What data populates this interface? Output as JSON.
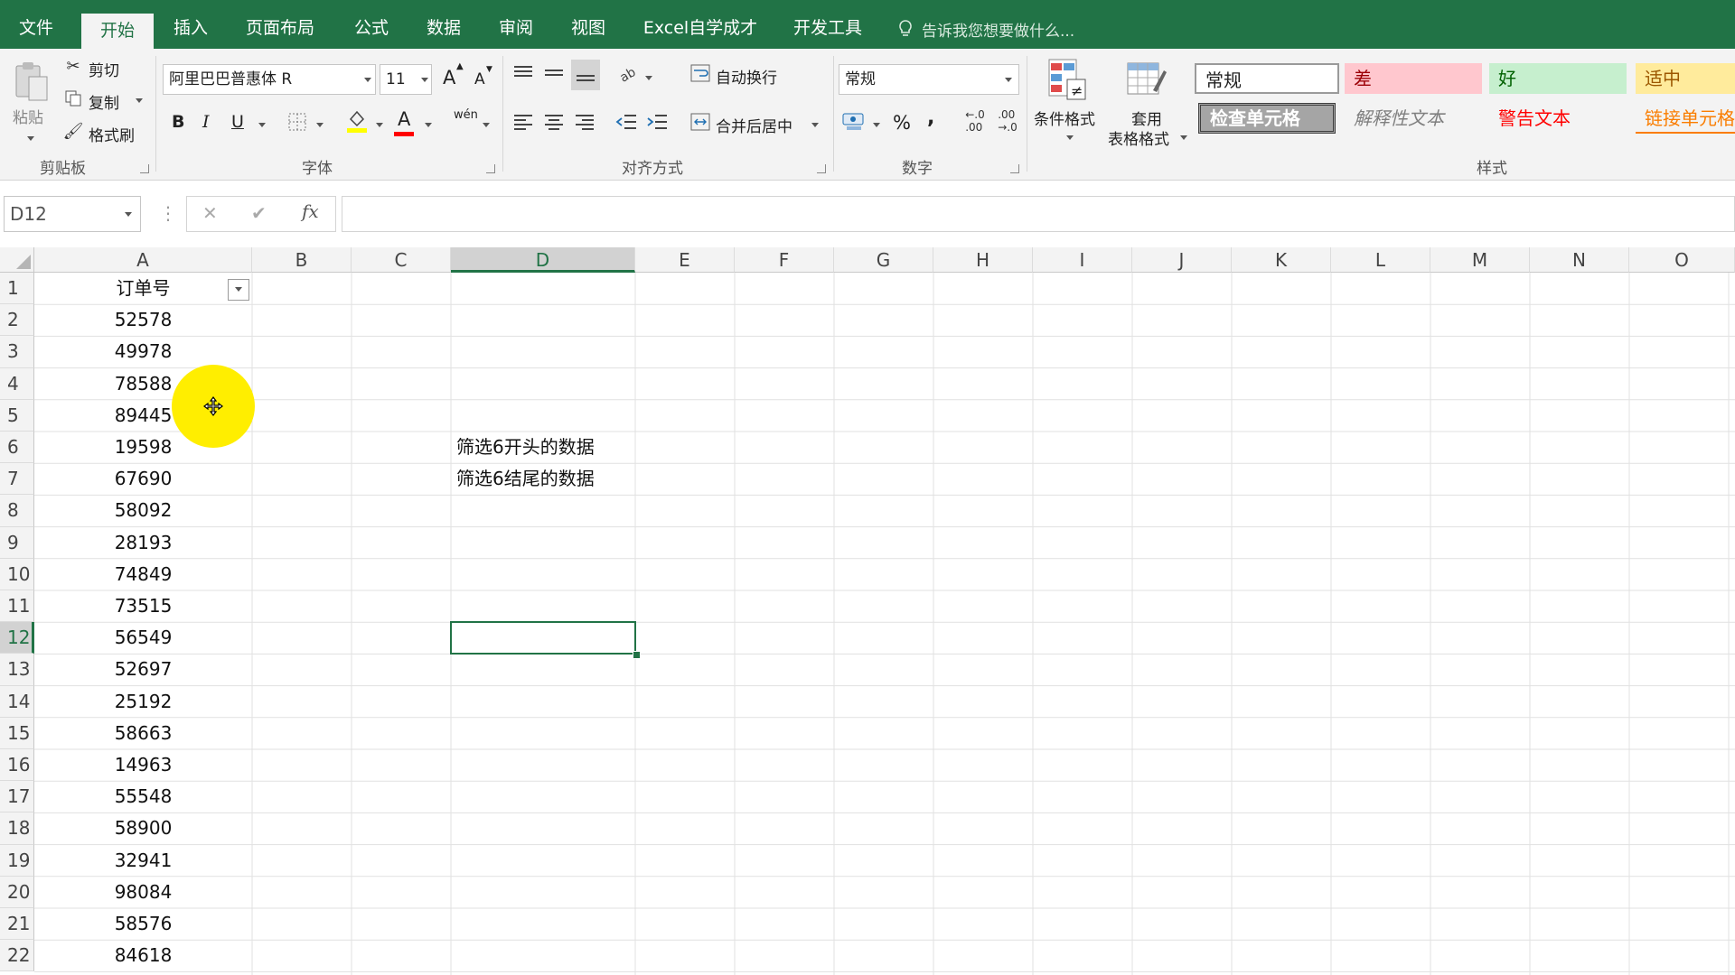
{
  "tabs": [
    "文件",
    "开始",
    "插入",
    "页面布局",
    "公式",
    "数据",
    "审阅",
    "视图",
    "Excel自学成才",
    "开发工具"
  ],
  "active_tab": "开始",
  "tell_me": "告诉我您想要做什么...",
  "clipboard": {
    "paste": "粘贴",
    "cut": "剪切",
    "copy": "复制",
    "format_painter": "格式刷",
    "group": "剪贴板"
  },
  "font": {
    "name": "阿里巴巴普惠体 R",
    "size": "11",
    "bold": "B",
    "italic": "I",
    "underline": "U",
    "group": "字体",
    "grow": "A",
    "shrink": "A",
    "color_letter": "A",
    "phonetic": "wén"
  },
  "alignment": {
    "wrap": "自动换行",
    "merge": "合并后居中",
    "group": "对齐方式"
  },
  "number": {
    "format": "常规",
    "percent": "%",
    "comma": ",",
    "group": "数字"
  },
  "styles": {
    "conditional": "条件格式",
    "table_format_1": "套用",
    "table_format_2": "表格格式",
    "group": "样式",
    "normal": "常规",
    "bad": "差",
    "good": "好",
    "neutral": "适中",
    "check_cell": "检查单元格",
    "explanatory": "解释性文本",
    "warning": "警告文本",
    "linked": "链接单元格"
  },
  "name_box": "D12",
  "formula_icons": {
    "cancel": "✕",
    "enter": "✔",
    "fx": "fx"
  },
  "columns": [
    "A",
    "B",
    "C",
    "D",
    "E",
    "F",
    "G",
    "H",
    "I",
    "J",
    "K",
    "L",
    "M",
    "N",
    "O"
  ],
  "selected_column": "D",
  "selected_row": "12",
  "rows": [
    "1",
    "2",
    "3",
    "4",
    "5",
    "6",
    "7",
    "8",
    "9",
    "10",
    "11",
    "12",
    "13",
    "14",
    "15",
    "16",
    "17",
    "18",
    "19",
    "20",
    "21",
    "22"
  ],
  "col_a": [
    "订单号",
    "52578",
    "49978",
    "78588",
    "89445",
    "19598",
    "67690",
    "58092",
    "28193",
    "74849",
    "73515",
    "56549",
    "52697",
    "25192",
    "58663",
    "14963",
    "55548",
    "58900",
    "32941",
    "98084",
    "58576",
    "84618"
  ],
  "col_d": {
    "row6": "筛选6开头的数据",
    "row7": "筛选6结尾的数据"
  },
  "colors": {
    "accent": "#217346",
    "bad_bg": "#ffc7ce",
    "bad_fg": "#9c0006",
    "good_bg": "#c6efce",
    "good_fg": "#006100",
    "neutral_bg": "#ffeb9c",
    "neutral_fg": "#9c5700",
    "warning_fg": "#ff0000",
    "linked_fg": "#fa7d00",
    "cursor_highlight": "#ffee00"
  }
}
